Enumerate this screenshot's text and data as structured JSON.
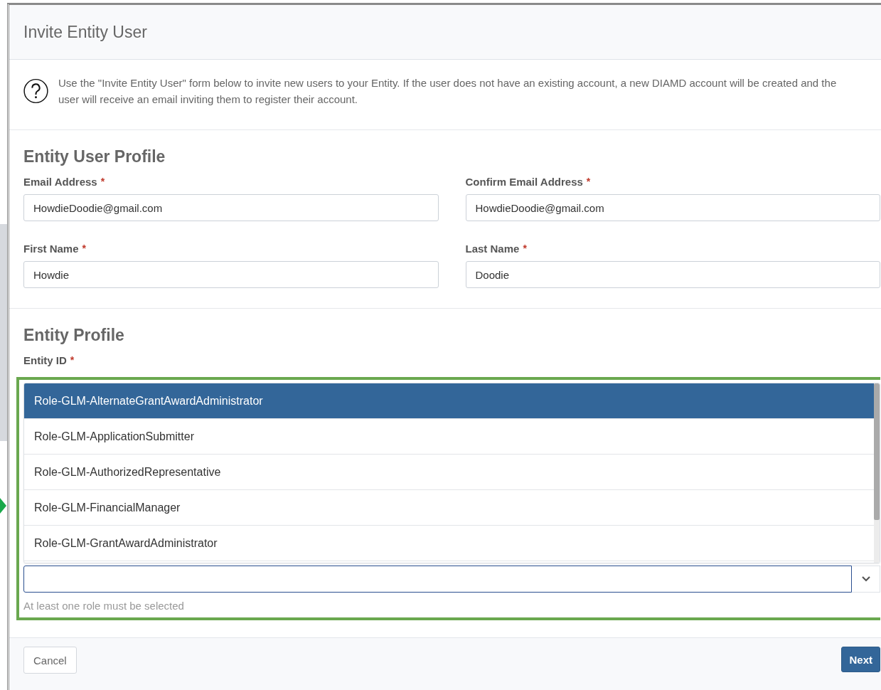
{
  "title": "Invite Entity User",
  "info": "Use the \"Invite Entity User\" form below to invite new users to your Entity. If the user does not have an existing account, a new DIAMD account will be created and the user will receive an email inviting them to register their account.",
  "sections": [
    {
      "heading": "Entity User Profile",
      "fields": [
        {
          "label": "Email Address",
          "marker": "*",
          "value": "HowdieDoodie@gmail.com"
        },
        {
          "label": "Confirm Email Address",
          "marker": "*",
          "value": "HowdieDoodie@gmail.com"
        },
        {
          "label": "First Name",
          "marker": "*",
          "value": "Howdie"
        },
        {
          "label": "Last Name",
          "marker": "*",
          "value": "Doodie"
        }
      ]
    },
    {
      "heading": "Entity Profile",
      "fields": [
        {
          "label": "Entity ID",
          "marker": "*"
        }
      ]
    }
  ],
  "roles": {
    "options": [
      {
        "label": "Role-GLM-AlternateGrantAwardAdministrator",
        "selected": true
      },
      {
        "label": "Role-GLM-ApplicationSubmitter",
        "selected": false
      },
      {
        "label": "Role-GLM-AuthorizedRepresentative",
        "selected": false
      },
      {
        "label": "Role-GLM-FinancialManager",
        "selected": false
      },
      {
        "label": "Role-GLM-GrantAwardAdministrator",
        "selected": false
      }
    ],
    "hint": "At least one role must be selected"
  },
  "buttons": [
    {
      "label": "Cancel",
      "kind": "secondary"
    },
    {
      "label": "Next",
      "kind": "primary"
    }
  ]
}
